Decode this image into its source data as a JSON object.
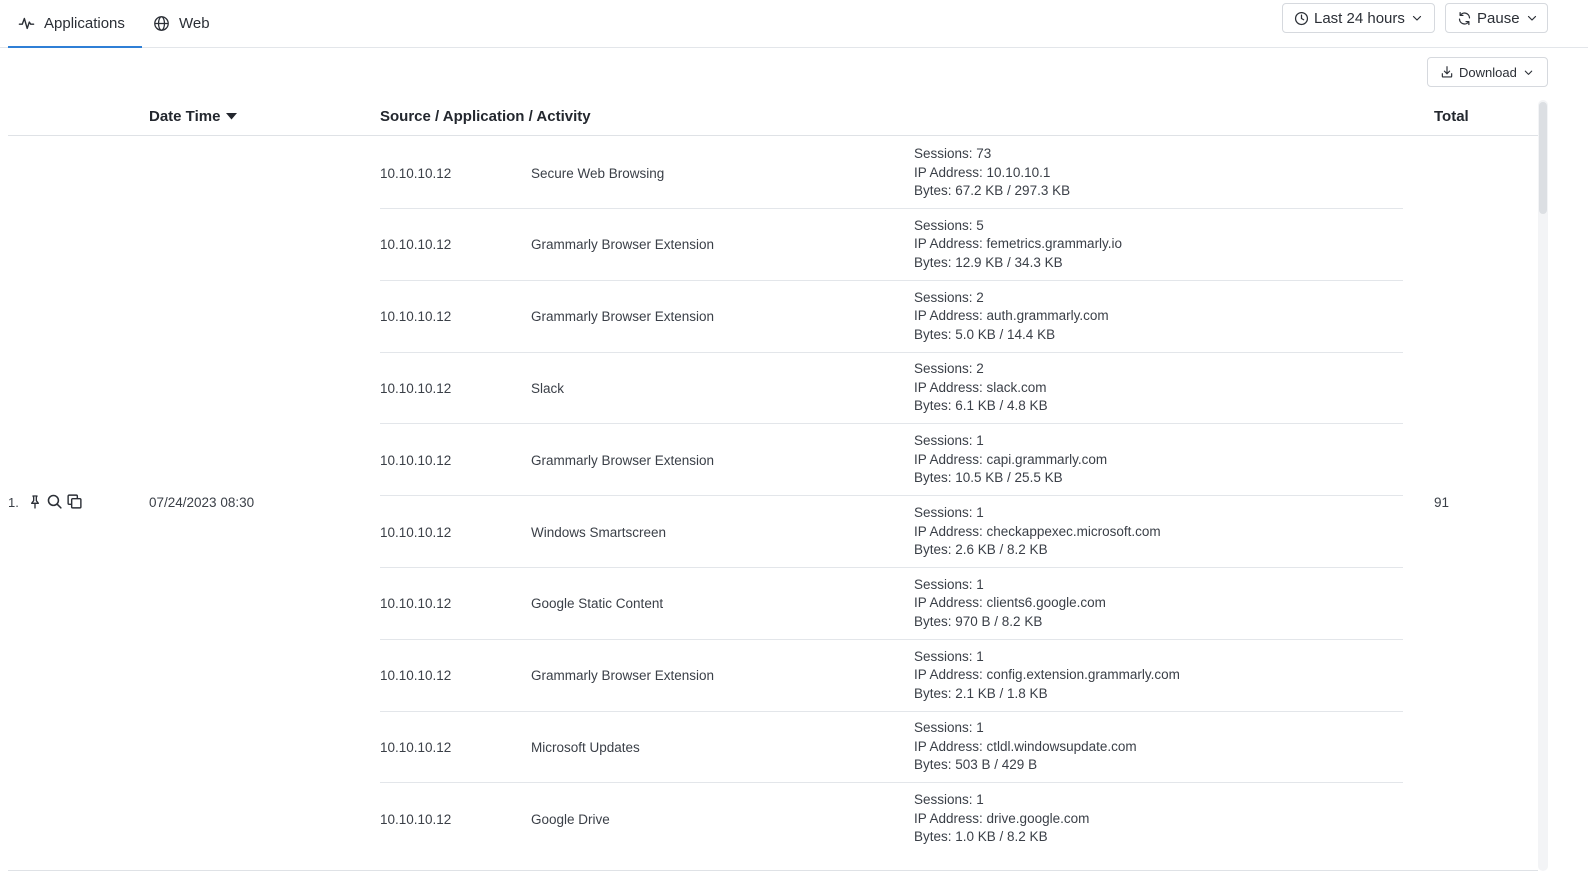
{
  "tabs": [
    {
      "label": "Applications",
      "icon": "activity-icon",
      "active": true
    },
    {
      "label": "Web",
      "icon": "globe-icon",
      "active": false
    }
  ],
  "toolbar": {
    "time_range": "Last 24 hours",
    "pause": "Pause",
    "download": "Download"
  },
  "table": {
    "columns": {
      "date_time": "Date Time",
      "source_app_activity": "Source / Application / Activity",
      "total": "Total"
    },
    "group": {
      "index": "1.",
      "date_time": "07/24/2023 08:30",
      "total": "91",
      "rows": [
        {
          "source": "10.10.10.12",
          "application": "Secure Web Browsing",
          "sessions": "Sessions: 73",
          "ip": "IP Address: 10.10.10.1",
          "bytes": "Bytes: 67.2 KB / 297.3 KB"
        },
        {
          "source": "10.10.10.12",
          "application": "Grammarly Browser Extension",
          "sessions": "Sessions: 5",
          "ip": "IP Address: femetrics.grammarly.io",
          "bytes": "Bytes: 12.9 KB / 34.3 KB"
        },
        {
          "source": "10.10.10.12",
          "application": "Grammarly Browser Extension",
          "sessions": "Sessions: 2",
          "ip": "IP Address: auth.grammarly.com",
          "bytes": "Bytes: 5.0 KB / 14.4 KB"
        },
        {
          "source": "10.10.10.12",
          "application": "Slack",
          "sessions": "Sessions: 2",
          "ip": "IP Address: slack.com",
          "bytes": "Bytes: 6.1 KB / 4.8 KB"
        },
        {
          "source": "10.10.10.12",
          "application": "Grammarly Browser Extension",
          "sessions": "Sessions: 1",
          "ip": "IP Address: capi.grammarly.com",
          "bytes": "Bytes: 10.5 KB / 25.5 KB"
        },
        {
          "source": "10.10.10.12",
          "application": "Windows Smartscreen",
          "sessions": "Sessions: 1",
          "ip": "IP Address: checkappexec.microsoft.com",
          "bytes": "Bytes: 2.6 KB / 8.2 KB"
        },
        {
          "source": "10.10.10.12",
          "application": "Google Static Content",
          "sessions": "Sessions: 1",
          "ip": "IP Address: clients6.google.com",
          "bytes": "Bytes: 970 B / 8.2 KB"
        },
        {
          "source": "10.10.10.12",
          "application": "Grammarly Browser Extension",
          "sessions": "Sessions: 1",
          "ip": "IP Address: config.extension.grammarly.com",
          "bytes": "Bytes: 2.1 KB / 1.8 KB"
        },
        {
          "source": "10.10.10.12",
          "application": "Microsoft Updates",
          "sessions": "Sessions: 1",
          "ip": "IP Address: ctldl.windowsupdate.com",
          "bytes": "Bytes: 503 B / 429 B"
        },
        {
          "source": "10.10.10.12",
          "application": "Google Drive",
          "sessions": "Sessions: 1",
          "ip": "IP Address: drive.google.com",
          "bytes": "Bytes: 1.0 KB / 8.2 KB"
        }
      ]
    }
  },
  "icons": {
    "row_actions": [
      "pin-icon",
      "search-icon",
      "copy-icon"
    ]
  },
  "colors": {
    "accent": "#2f7fd6",
    "border": "#dfe2e6",
    "text": "#2b2f36"
  }
}
